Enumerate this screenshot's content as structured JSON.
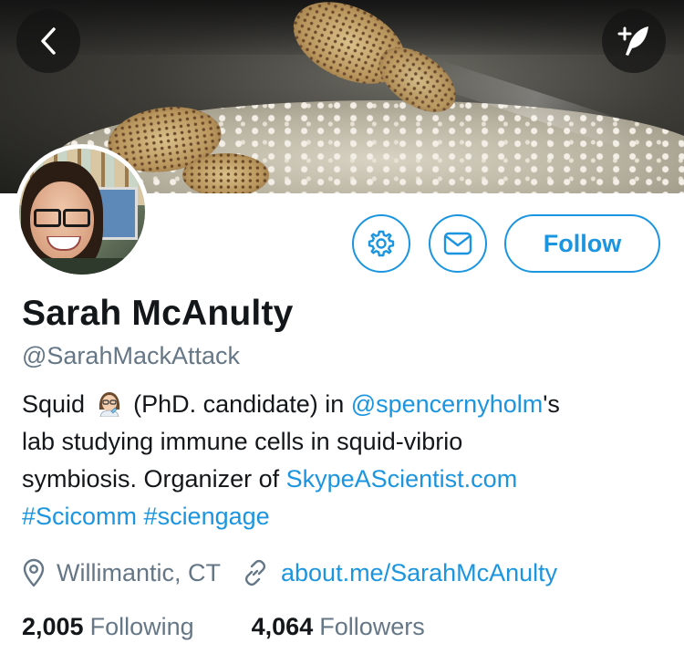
{
  "header": {
    "back_icon": "chevron-left-icon",
    "compose_icon": "compose-tweet-icon"
  },
  "actions": {
    "settings_icon": "gear-icon",
    "message_icon": "envelope-icon",
    "follow_label": "Follow"
  },
  "profile": {
    "name": "Sarah McAnulty",
    "handle": "@SarahMackAttack",
    "bio": {
      "line1_pre": "Squid",
      "line1_emoji": "woman-scientist-emoji",
      "line1_mid": "(PhD. candidate) in ",
      "line1_mention": "@spencernyholm",
      "line1_post": "'s",
      "line2": "lab studying immune cells in squid-vibrio",
      "line3_pre": "symbiosis. Organizer of ",
      "line3_link": "SkypeAScientist.com",
      "line4_tag1": "#Scicomm",
      "line4_tag2": "#sciengage"
    },
    "location": "Willimantic, CT",
    "website": "about.me/SarahMcAnulty",
    "following_count": "2,005",
    "following_label": "Following",
    "followers_count": "4,064",
    "followers_label": "Followers"
  },
  "colors": {
    "accent": "#1b95e0",
    "text_primary": "#14171a",
    "text_secondary": "#657786"
  }
}
